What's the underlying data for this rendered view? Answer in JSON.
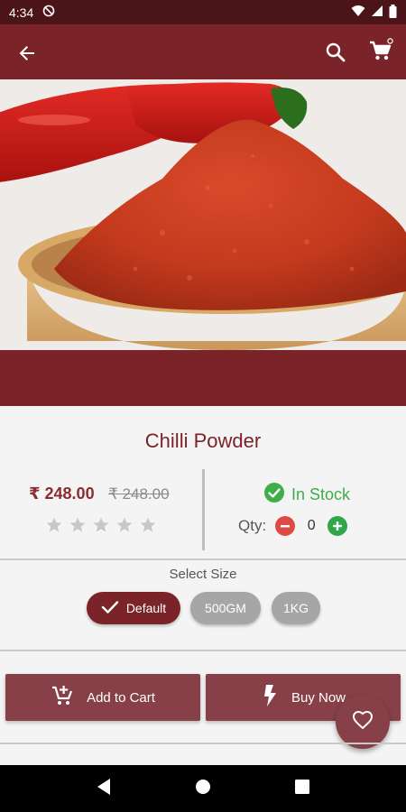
{
  "status_bar": {
    "time": "4:34",
    "icons": [
      "do-not-disturb-icon",
      "wifi-icon",
      "signal-icon",
      "battery-icon"
    ]
  },
  "app_bar": {
    "background": "#7a2328",
    "icons": [
      "back-arrow-icon",
      "search-icon",
      "cart-icon"
    ]
  },
  "product": {
    "name": "Chilli Powder",
    "price": "₹ 248.00",
    "original_price": "₹ 248.00",
    "rating": 0,
    "rating_max": 5,
    "stock_status": "In Stock",
    "qty_label": "Qty:",
    "qty_value": "0"
  },
  "size": {
    "label": "Select Size",
    "options": [
      {
        "label": "Default",
        "selected": true
      },
      {
        "label": "500GM",
        "selected": false
      },
      {
        "label": "1KG",
        "selected": false
      }
    ]
  },
  "actions": {
    "add_to_cart": "Add to Cart",
    "buy_now": "Buy Now"
  },
  "colors": {
    "accent": "#7a2328",
    "button": "#874047",
    "in_stock": "#3fae49",
    "minus": "#e04a46",
    "plus": "#2fa84a",
    "chip_unselected": "#a6a6a6"
  }
}
